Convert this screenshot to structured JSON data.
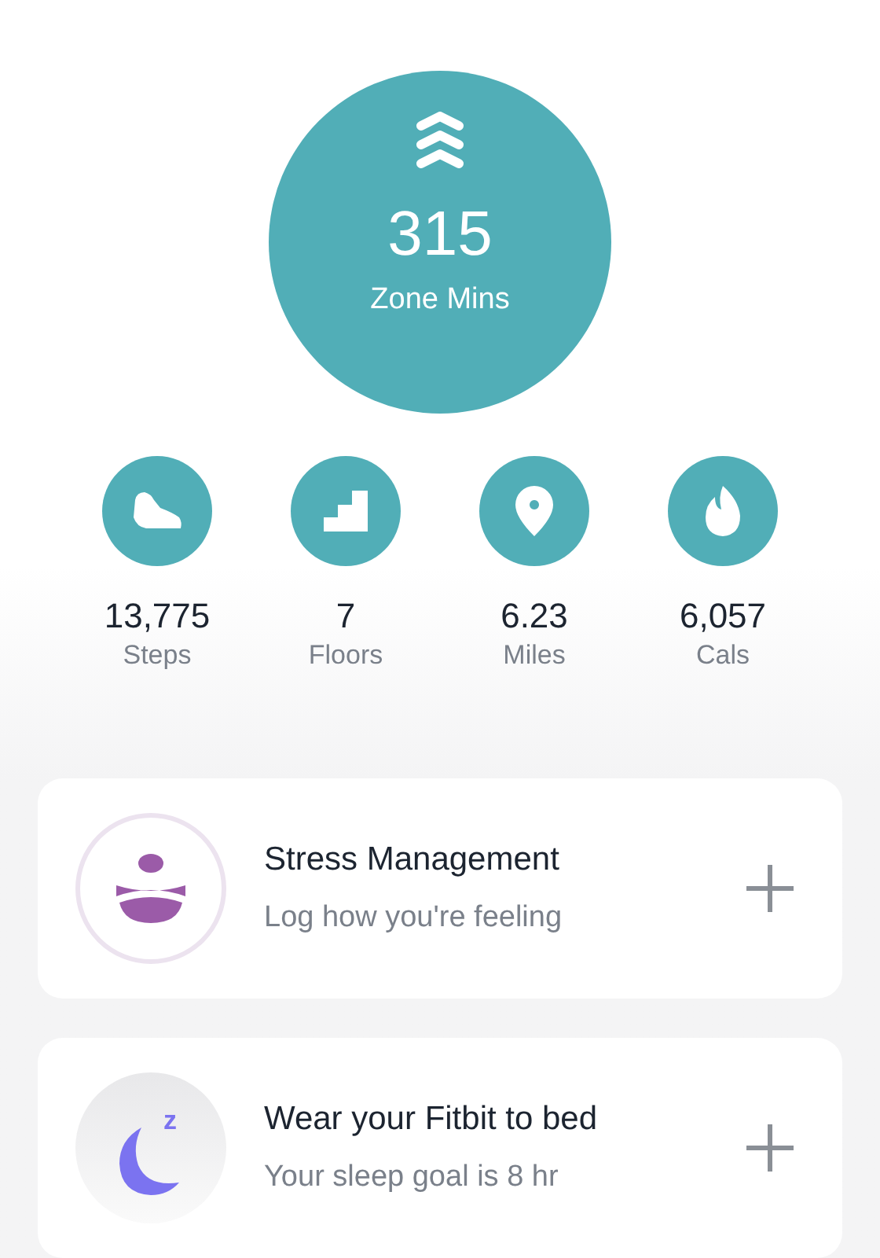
{
  "zone": {
    "value": "315",
    "label": "Zone Mins"
  },
  "stats": [
    {
      "kind": "steps",
      "value": "13,775",
      "label": "Steps"
    },
    {
      "kind": "floors",
      "value": "7",
      "label": "Floors"
    },
    {
      "kind": "miles",
      "value": "6.23",
      "label": "Miles"
    },
    {
      "kind": "cals",
      "value": "6,057",
      "label": "Cals"
    }
  ],
  "cards": [
    {
      "kind": "stress",
      "title": "Stress Management",
      "subtitle": "Log how you're feeling"
    },
    {
      "kind": "sleep",
      "title": "Wear your Fitbit to bed",
      "subtitle": "Your sleep goal is 8 hr",
      "badge": "z"
    }
  ]
}
